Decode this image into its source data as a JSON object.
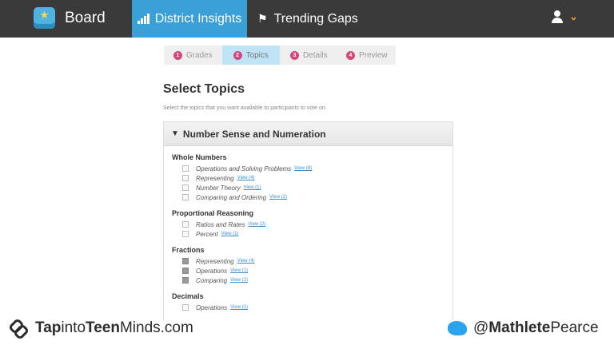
{
  "app": {
    "name": "Board"
  },
  "nav": {
    "tabs": [
      {
        "label": "District Insights",
        "active": true
      },
      {
        "label": "Trending Gaps",
        "active": false
      }
    ]
  },
  "steps": [
    {
      "num": "1",
      "label": "Grades"
    },
    {
      "num": "2",
      "label": "Topics",
      "current": true
    },
    {
      "num": "3",
      "label": "Details"
    },
    {
      "num": "4",
      "label": "Preview"
    }
  ],
  "page": {
    "title": "Select Topics",
    "subtitle": "Select the topics that you want available to participants to vote on."
  },
  "panel": {
    "title": "Number Sense and Numeration",
    "groups": [
      {
        "title": "Whole Numbers",
        "items": [
          {
            "label": "Operations and Solving Problems",
            "view": "View (8)",
            "checked": false
          },
          {
            "label": "Representing",
            "view": "View (4)",
            "checked": false
          },
          {
            "label": "Number Theory",
            "view": "View (1)",
            "checked": false
          },
          {
            "label": "Comparing and Ordering",
            "view": "View (2)",
            "checked": false
          }
        ]
      },
      {
        "title": "Proportional Reasoning",
        "items": [
          {
            "label": "Ratios and Rates",
            "view": "View (2)",
            "checked": false
          },
          {
            "label": "Percent",
            "view": "View (1)",
            "checked": false
          }
        ]
      },
      {
        "title": "Fractions",
        "items": [
          {
            "label": "Representing",
            "view": "View (4)",
            "checked": true
          },
          {
            "label": "Operations",
            "view": "View (1)",
            "checked": true
          },
          {
            "label": "Comparing",
            "view": "View (2)",
            "checked": true
          }
        ]
      },
      {
        "title": "Decimals",
        "items": [
          {
            "label": "Operations",
            "view": "View (1)",
            "checked": false
          }
        ]
      }
    ]
  },
  "footer": {
    "left_part1": "Tap",
    "left_part2": "into",
    "left_part3": "Teen",
    "left_part4": "Minds.com",
    "right_part1": "@",
    "right_part2": "Mathlete",
    "right_part3": "Pearce"
  },
  "colors": {
    "topbar": "#3a3a3a",
    "accent": "#3b9fd8",
    "step_badge": "#d6457b",
    "link": "#3b8fd0"
  },
  "icons": {
    "logo": "star-board-icon",
    "district": "signal-bars-icon",
    "gaps": "flag-icon",
    "user": "user-icon",
    "chevron": "chevron-down-icon",
    "caret": "caret-down-icon"
  }
}
